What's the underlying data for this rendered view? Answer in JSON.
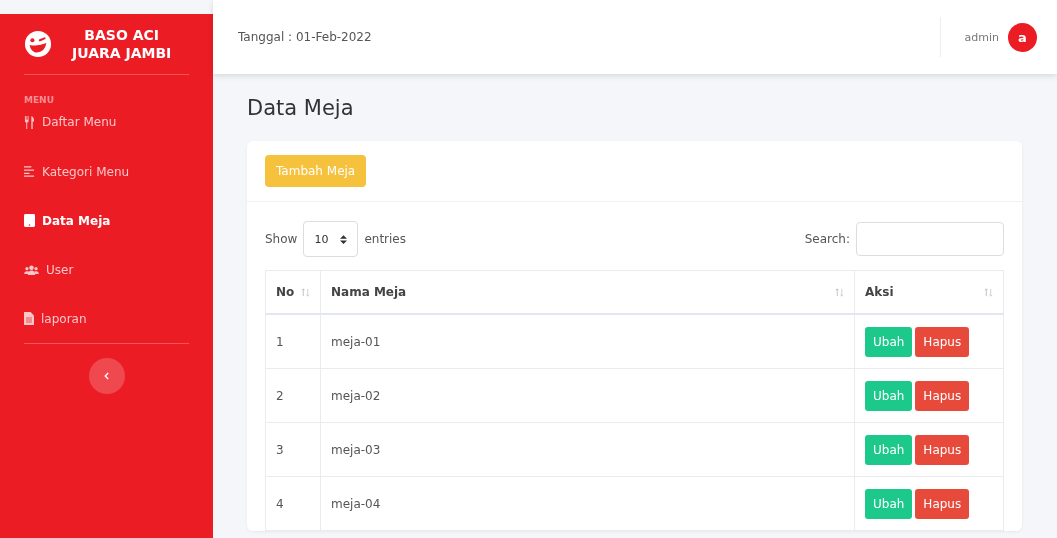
{
  "brand": {
    "line1": "BASO ACI",
    "line2": "JUARA JAMBI"
  },
  "sidebar": {
    "heading": "MENU",
    "items": [
      {
        "label": "Daftar Menu",
        "kind": "utensils",
        "selected": false
      },
      {
        "label": "Kategori Menu",
        "kind": "lines",
        "selected": false
      },
      {
        "label": "Data Meja",
        "kind": "tablet",
        "selected": true
      },
      {
        "label": "User",
        "kind": "users",
        "selected": false
      },
      {
        "label": "laporan",
        "kind": "file",
        "selected": false
      }
    ]
  },
  "topbar": {
    "date": "Tanggal : 01-Feb-2022",
    "user": "admin",
    "avatar": "a"
  },
  "page_title": "Data Meja",
  "card": {
    "add_button": "Tambah Meja",
    "show_label": "Show",
    "page_size": "10",
    "entries_label": "entries",
    "search_label": "Search:",
    "table": {
      "columns": [
        "No",
        "Nama Meja",
        "Aksi"
      ],
      "rows": [
        {
          "no": "1",
          "name": "meja-01",
          "edit_label": "Ubah",
          "delete_label": "Hapus"
        },
        {
          "no": "2",
          "name": "meja-02",
          "edit_label": "Ubah",
          "delete_label": "Hapus"
        },
        {
          "no": "3",
          "name": "meja-03",
          "edit_label": "Ubah",
          "delete_label": "Hapus"
        },
        {
          "no": "4",
          "name": "meja-04",
          "edit_label": "Ubah",
          "delete_label": "Hapus"
        }
      ]
    }
  }
}
